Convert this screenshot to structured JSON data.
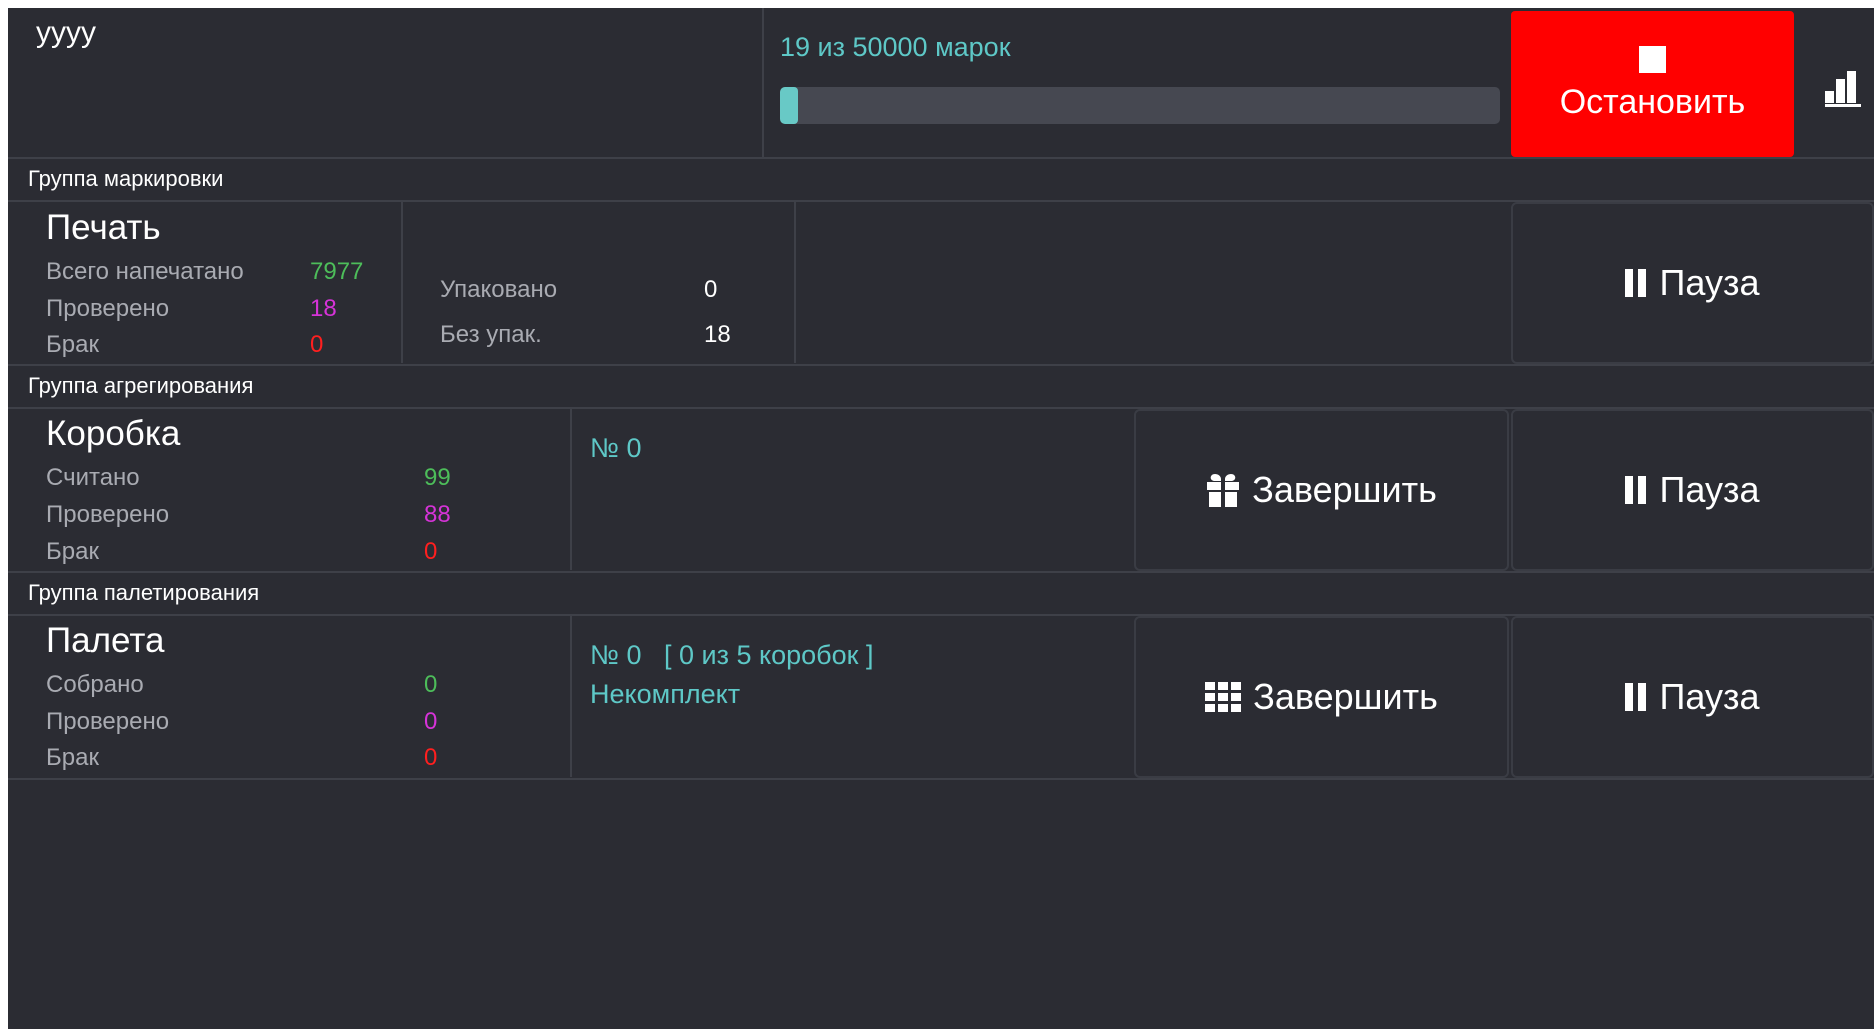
{
  "header": {
    "title": "уууу",
    "progress_text": "19 из 50000 марок",
    "progress_fraction": 0.00038,
    "stop_label": "Остановить"
  },
  "marking": {
    "group_label": "Группа маркировки",
    "title": "Печать",
    "stats": [
      {
        "label": "Всего напечатано",
        "value": "7977"
      },
      {
        "label": "Проверено",
        "value": "18"
      },
      {
        "label": "Брак",
        "value": "0"
      }
    ],
    "packed_label": "Упаковано",
    "packed_value": "0",
    "unpacked_label": "Без упак.",
    "unpacked_value": "18",
    "pause_label": "Пауза"
  },
  "aggregation": {
    "group_label": "Группа агрегирования",
    "title": "Коробка",
    "stats": [
      {
        "label": "Считано",
        "value": "99"
      },
      {
        "label": "Проверено",
        "value": "88"
      },
      {
        "label": "Брак",
        "value": "0"
      }
    ],
    "number_text": "№ 0",
    "finish_label": "Завершить",
    "pause_label": "Пауза"
  },
  "palletizing": {
    "group_label": "Группа палетирования",
    "title": "Палета",
    "stats": [
      {
        "label": "Собрано",
        "value": "0"
      },
      {
        "label": "Проверено",
        "value": "0"
      },
      {
        "label": "Брак",
        "value": "0"
      }
    ],
    "number_text": "№ 0   [ 0 из 5 коробок ]",
    "status_text": "Некомплект",
    "finish_label": "Завершить",
    "pause_label": "Пауза"
  },
  "icons": {
    "stop": "stop-square-icon",
    "stats": "bar-chart-icon",
    "pause": "pause-icon",
    "finish_box": "gift-icon",
    "finish_pallet": "grid-icon"
  },
  "colors": {
    "background": "#2b2c33",
    "accent_cyan": "#5ec8c7",
    "stop_red": "#ff0000",
    "ok_green": "#4dbd5a",
    "checked_magenta": "#d633d8",
    "defect_red": "#ff1f1f"
  }
}
